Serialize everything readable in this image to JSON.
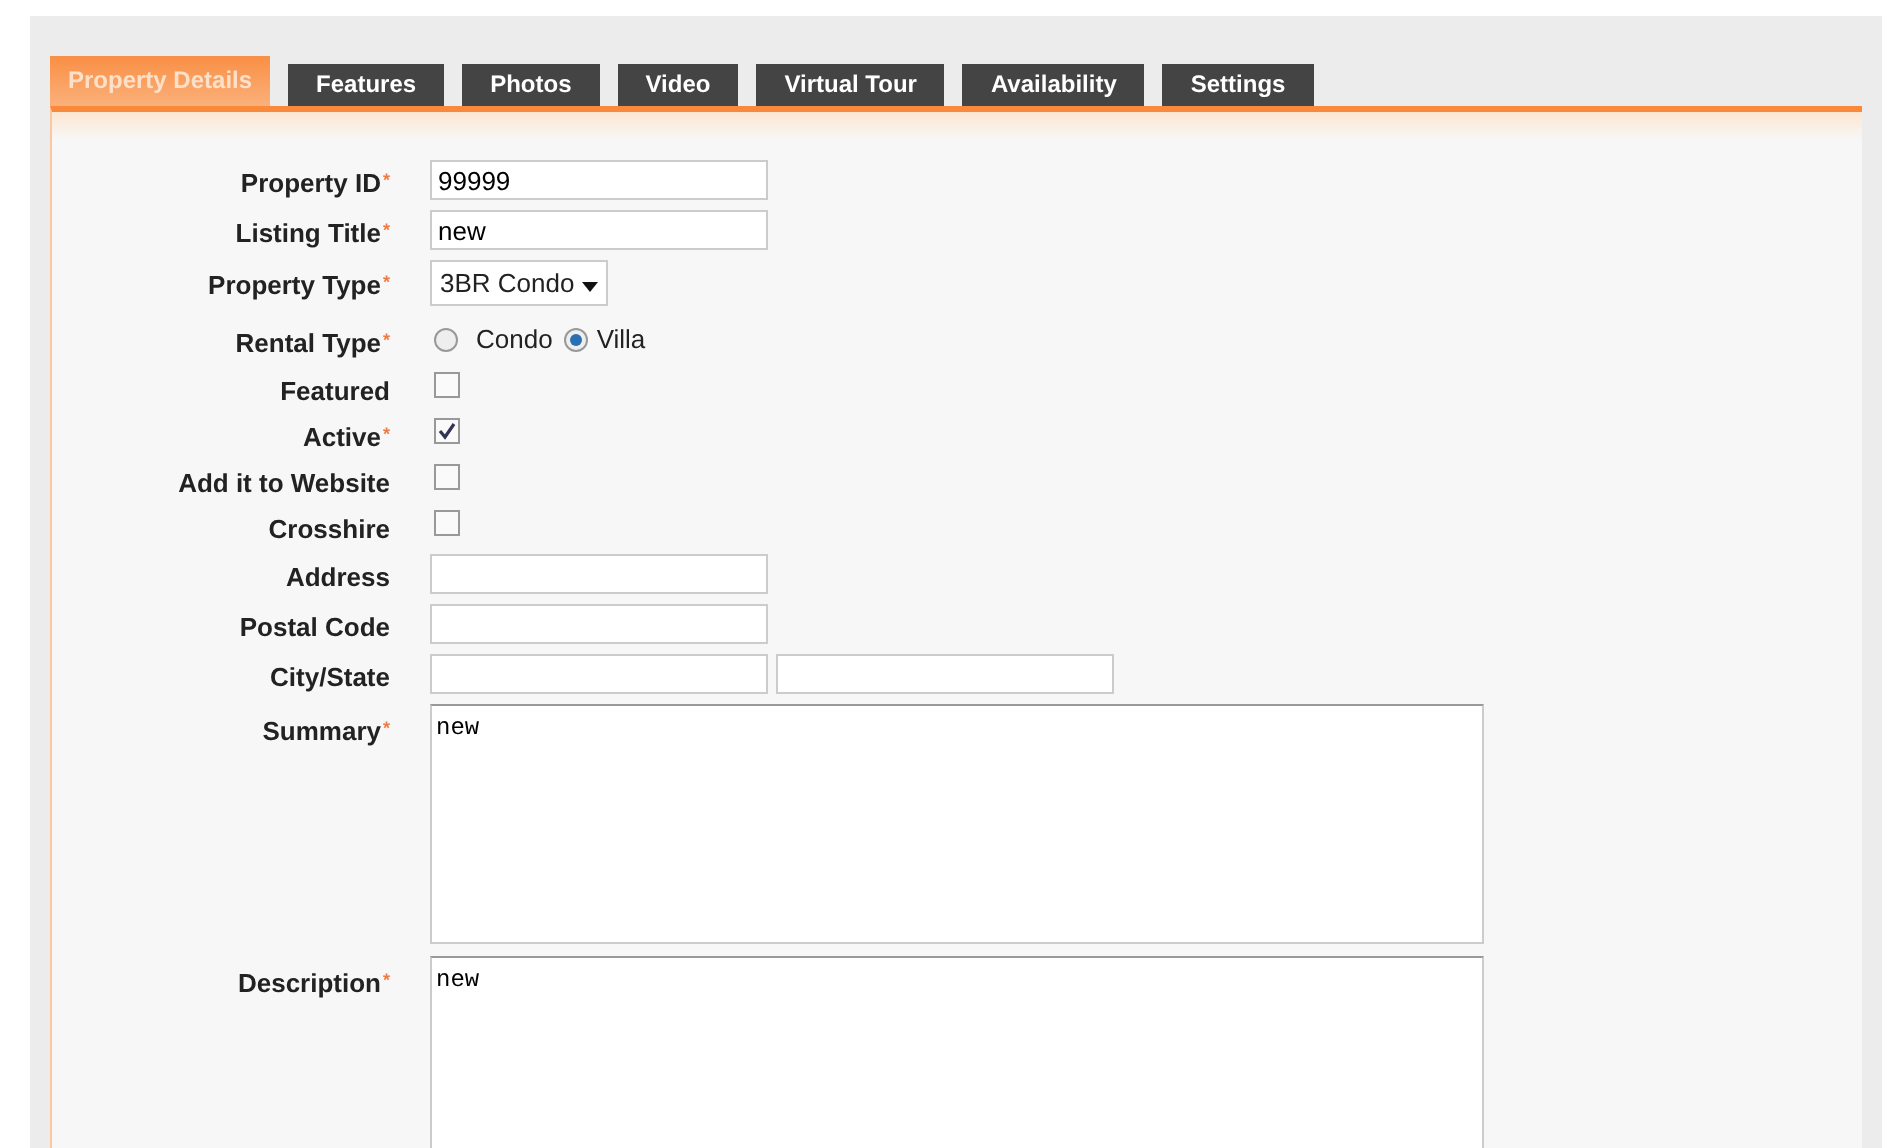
{
  "tabs": [
    {
      "label": "Property Details",
      "selected": true
    },
    {
      "label": "Features",
      "selected": false
    },
    {
      "label": "Photos",
      "selected": false
    },
    {
      "label": "Video",
      "selected": false
    },
    {
      "label": "Virtual Tour",
      "selected": false
    },
    {
      "label": "Availability",
      "selected": false
    },
    {
      "label": "Settings",
      "selected": false
    }
  ],
  "fields": [
    {
      "kind": "text",
      "label": "Property ID$^{*}$",
      "value": "99999"
    },
    {
      "kind": "text",
      "label": "Listing Title$^{*}$",
      "value": "new"
    },
    {
      "kind": "select",
      "label": "Property Type$^{*}$",
      "value": "3BR Condo"
    },
    {
      "kind": "radio",
      "label": "Rental Type$^{*}$",
      "options": [
        {
          "label": "Condo",
          "selected": false
        },
        {
          "label": "Villa",
          "selected": true
        }
      ]
    },
    {
      "kind": "checkbox",
      "label": "Featured",
      "checked": false
    },
    {
      "kind": "checkbox",
      "label": "Active$^{*}$",
      "checked": true
    },
    {
      "kind": "checkbox",
      "label": "Add it to Website",
      "checked": false
    },
    {
      "kind": "checkbox",
      "label": "Crosshire",
      "checked": false
    },
    {
      "kind": "text",
      "label": "Address"
    },
    {
      "kind": "text",
      "label": "Postal Code"
    },
    {
      "kind": "pair",
      "label": "City/State"
    },
    {
      "kind": "textarea",
      "label": "Summary$^{*}$",
      "value": "new"
    },
    {
      "kind": "textarea",
      "label": "Description$^{*}$",
      "value": "new"
    }
  ]
}
